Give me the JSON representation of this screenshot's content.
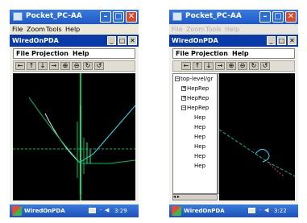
{
  "device_a": {
    "title": "Pocket_PC-AA",
    "menu": [
      "File",
      "Zoom",
      "Tools",
      "Help"
    ],
    "app_title": "WiredOnPDA",
    "app_menu": [
      "File",
      "Projection",
      "Help"
    ],
    "toolbar": [
      "←",
      "↑",
      "↓",
      "→",
      "⊕",
      "⊖",
      "↻",
      "↺"
    ],
    "taskbar_label": "WiredOnPDA",
    "clock": "3:29"
  },
  "device_b": {
    "title": "Pocket_PC-AA",
    "menu": [
      "File",
      "Zoom",
      "Tools",
      "Help"
    ],
    "app_title": "WiredOnPDA",
    "app_menu": [
      "File",
      "Projection",
      "Help"
    ],
    "toolbar": [
      "←",
      "↑",
      "↓",
      "→",
      "⊕",
      "⊖",
      "↻",
      "↺"
    ],
    "tree": {
      "root": "top-level/gr",
      "nodes": [
        "HepRep",
        "HepRep",
        "HepRep",
        "Hep",
        "Hep",
        "Hep",
        "Hep",
        "Hep",
        "Hep"
      ]
    },
    "taskbar_label": "WiredOnPDA",
    "clock": "3:22"
  },
  "colors": {
    "titlebar": "#1f58c8",
    "app_titlebar": "#0a3aa8",
    "canvas": "#000000",
    "track_green": "#00c060",
    "track_cyan": "#30e0ff"
  }
}
